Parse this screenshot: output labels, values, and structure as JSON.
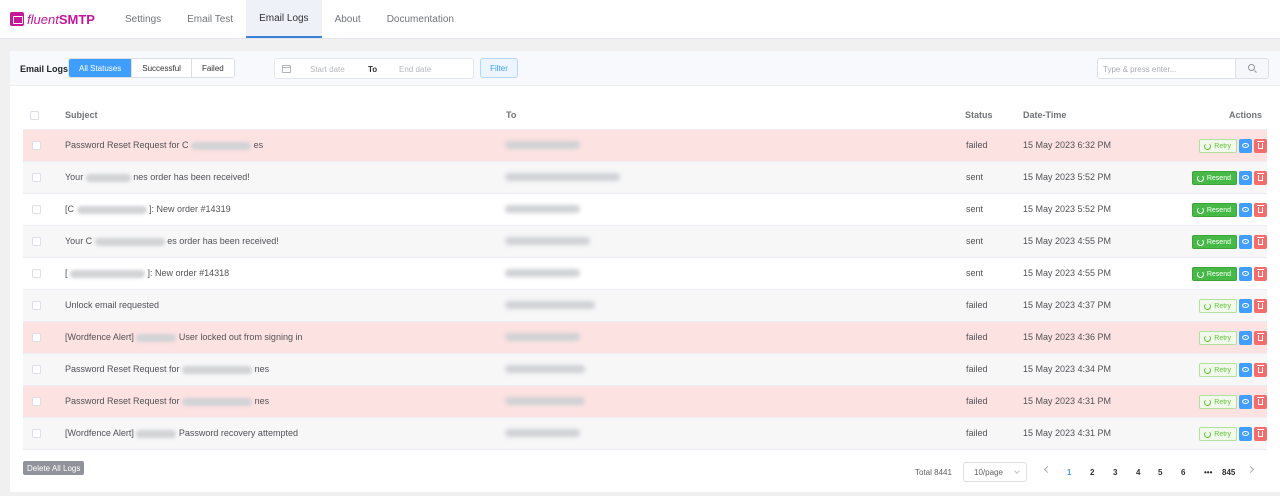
{
  "brand": {
    "name_italic": "fluent",
    "name_bold": "SMTP"
  },
  "nav": {
    "tabs": [
      {
        "label": "Settings"
      },
      {
        "label": "Email Test"
      },
      {
        "label": "Email Logs"
      },
      {
        "label": "About"
      },
      {
        "label": "Documentation"
      }
    ],
    "active": "Email Logs"
  },
  "filters": {
    "title": "Email Logs",
    "statuses": [
      "All Statuses",
      "Successful",
      "Failed"
    ],
    "active_status": "All Statuses",
    "start_placeholder": "Start date",
    "to_label": "To",
    "end_placeholder": "End date",
    "filter_label": "Filter",
    "search_placeholder": "Type & press enter..."
  },
  "table": {
    "columns": {
      "subject": "Subject",
      "to": "To",
      "status": "Status",
      "datetime": "Date-Time",
      "actions": "Actions"
    },
    "rows": [
      {
        "subject_pre": "Password Reset Request for C",
        "subject_post": "es",
        "status": "failed",
        "datetime": "15 May 2023 6:32 PM",
        "action": "Retry",
        "bg": "failed"
      },
      {
        "subject_pre": "Your",
        "subject_post": "nes order has been received!",
        "status": "sent",
        "datetime": "15 May 2023 5:52 PM",
        "action": "Resend",
        "bg": "sent"
      },
      {
        "subject_pre": "[C",
        "subject_post": "]: New order #14319",
        "status": "sent",
        "datetime": "15 May 2023 5:52 PM",
        "action": "Resend",
        "bg": "plain"
      },
      {
        "subject_pre": "Your C",
        "subject_post": "es order has been received!",
        "status": "sent",
        "datetime": "15 May 2023 4:55 PM",
        "action": "Resend",
        "bg": "sent"
      },
      {
        "subject_pre": "[",
        "subject_post": "]: New order #14318",
        "status": "sent",
        "datetime": "15 May 2023 4:55 PM",
        "action": "Resend",
        "bg": "plain"
      },
      {
        "subject_pre": "Unlock email requested",
        "subject_post": "",
        "status": "failed",
        "datetime": "15 May 2023 4:37 PM",
        "action": "Retry",
        "bg": "sent"
      },
      {
        "subject_pre": "[Wordfence Alert]",
        "subject_post": "User locked out from signing in",
        "status": "failed",
        "datetime": "15 May 2023 4:36 PM",
        "action": "Retry",
        "bg": "failed"
      },
      {
        "subject_pre": "Password Reset Request for",
        "subject_post": "nes",
        "status": "failed",
        "datetime": "15 May 2023 4:34 PM",
        "action": "Retry",
        "bg": "sent"
      },
      {
        "subject_pre": "Password Reset Request for",
        "subject_post": "nes",
        "status": "failed",
        "datetime": "15 May 2023 4:31 PM",
        "action": "Retry",
        "bg": "failed"
      },
      {
        "subject_pre": "[Wordfence Alert]",
        "subject_post": "Password recovery attempted",
        "status": "failed",
        "datetime": "15 May 2023 4:31 PM",
        "action": "Retry",
        "bg": "sent"
      }
    ]
  },
  "footer": {
    "delete_all": "Delete All Logs",
    "total": "Total 8441",
    "page_size": "10/page",
    "pages": [
      "1",
      "2",
      "3",
      "4",
      "5",
      "6",
      "•••",
      "845"
    ],
    "current_page": "1"
  },
  "colors": {
    "brand": "#c5169c",
    "primary": "#409eff",
    "success": "#46b946",
    "danger": "#f56c6c",
    "failed_row": "#fde2e2"
  }
}
